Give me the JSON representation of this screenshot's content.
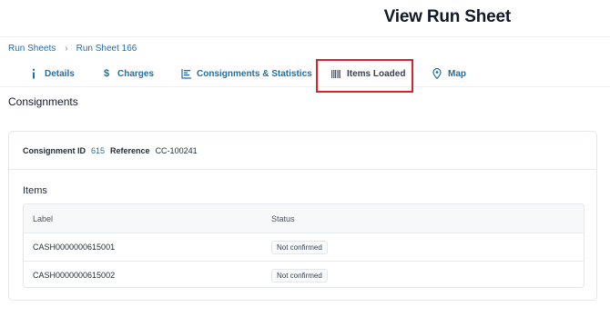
{
  "header": {
    "title": "View Run Sheet"
  },
  "breadcrumb": {
    "items": [
      "Run Sheets",
      "Run Sheet 166"
    ]
  },
  "tabs": [
    {
      "label": "Details",
      "icon": "info-icon"
    },
    {
      "label": "Charges",
      "icon": "dollar-icon"
    },
    {
      "label": "Consignments & Statistics",
      "icon": "bar-chart-icon"
    },
    {
      "label": "Items Loaded",
      "icon": "barcode-icon",
      "active": true
    },
    {
      "label": "Map",
      "icon": "map-pin-icon"
    }
  ],
  "section": {
    "heading": "Consignments"
  },
  "consignment": {
    "id_label": "Consignment ID",
    "id_value": "615",
    "reference_label": "Reference",
    "reference_value": "CC-100241"
  },
  "items": {
    "title": "Items",
    "columns": [
      "Label",
      "Status"
    ],
    "rows": [
      {
        "label": "CASH0000000615001",
        "status": "Not confirmed"
      },
      {
        "label": "CASH0000000615002",
        "status": "Not confirmed"
      }
    ]
  },
  "colors": {
    "link": "#1d6fa5",
    "highlight": "#d9242b"
  }
}
